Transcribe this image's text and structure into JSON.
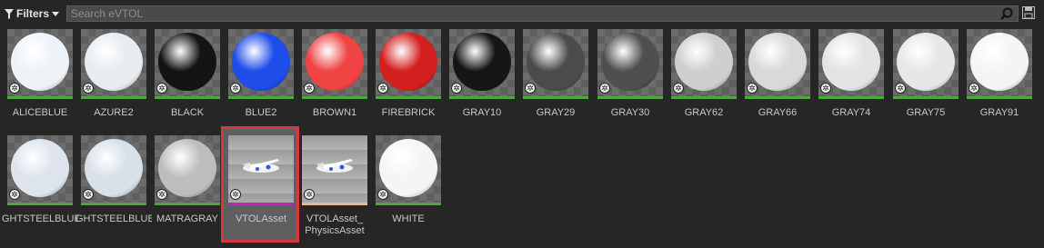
{
  "toolbar": {
    "filters_label": "Filters",
    "search_placeholder": "Search eVTOL"
  },
  "assets": [
    {
      "label": "ALICEBLUE",
      "kind": "sphere",
      "color": "#eef3f8"
    },
    {
      "label": "AZURE2",
      "kind": "sphere",
      "color": "#e6ecef"
    },
    {
      "label": "BLACK",
      "kind": "sphere",
      "color": "#141414"
    },
    {
      "label": "BLUE2",
      "kind": "sphere",
      "color": "#1e4dea"
    },
    {
      "label": "BROWN1",
      "kind": "sphere",
      "color": "#f04444"
    },
    {
      "label": "FIREBRICK",
      "kind": "sphere",
      "color": "#d41f1f"
    },
    {
      "label": "GRAY10",
      "kind": "sphere",
      "color": "#161616"
    },
    {
      "label": "GRAY29",
      "kind": "sphere",
      "color": "#4b4b4b"
    },
    {
      "label": "GRAY30",
      "kind": "sphere",
      "color": "#4f4f4f"
    },
    {
      "label": "GRAY62",
      "kind": "sphere",
      "color": "#cfcfcf"
    },
    {
      "label": "GRAY66",
      "kind": "sphere",
      "color": "#d9d9d9"
    },
    {
      "label": "GRAY74",
      "kind": "sphere",
      "color": "#e2e4e6"
    },
    {
      "label": "GRAY75",
      "kind": "sphere",
      "color": "#e6e7e8"
    },
    {
      "label": "GRAY91",
      "kind": "sphere",
      "color": "#f4f5f6"
    },
    {
      "label": "GHTSTEELBLUE",
      "kind": "sphere",
      "color": "#dde4ec"
    },
    {
      "label": "GHTSTEELBLUE",
      "kind": "sphere",
      "color": "#d8e0e8"
    },
    {
      "label": "MATRAGRAY",
      "kind": "sphere",
      "color": "#bdbdbd"
    },
    {
      "label": "VTOLAsset",
      "kind": "plane",
      "bar_color": "#c421c4"
    },
    {
      "label": "VTOLAsset_ PhysicsAsset",
      "kind": "plane",
      "bar_color": "#e7b98c"
    },
    {
      "label": "WHITE",
      "kind": "sphere",
      "color": "#f5f5f5"
    }
  ],
  "colors": {
    "selection": "#d8383a",
    "material_bar": "#4aa93a"
  }
}
